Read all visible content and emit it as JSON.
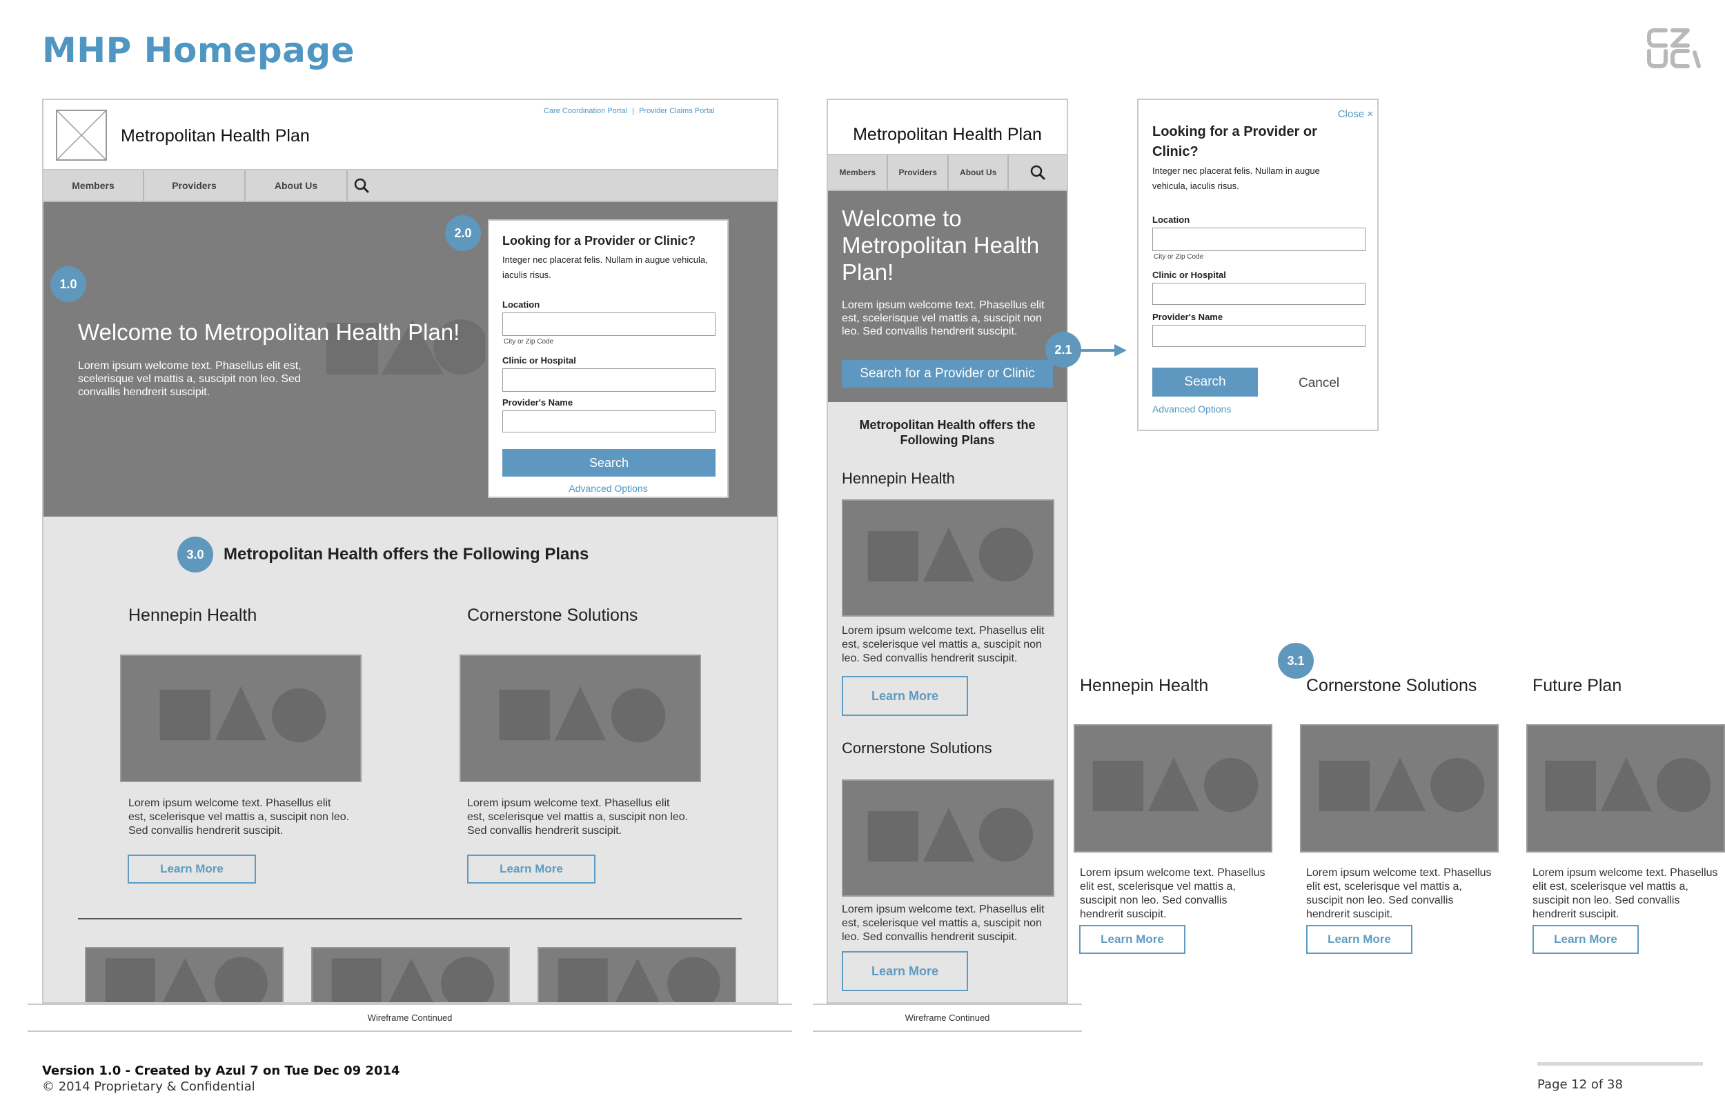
{
  "doc": {
    "title": "MHP Homepage",
    "version_line": "Version 1.0 - Created by Azul 7 on Tue Dec 09 2014",
    "copyright": "© 2014 Proprietary & Confidential",
    "page": "Page 12 of 38",
    "continued": "Wireframe Continued",
    "logo_top": "CZ",
    "logo_bottom": "UC"
  },
  "desktop": {
    "site_name": "Metropolitan Health Plan",
    "util_links": {
      "care": "Care Coordination Portal",
      "divider": "|",
      "claims": "Provider Claims Portal"
    },
    "nav": [
      "Members",
      "Providers",
      "About Us"
    ],
    "hero": {
      "badge": "1.0",
      "heading": "Welcome to Metropolitan Health Plan!",
      "text": "Lorem ipsum welcome text. Phasellus elit est, scelerisque vel mattis a, suscipit non leo. Sed convallis hendrerit suscipit."
    },
    "search": {
      "badge": "2.0",
      "title": "Looking for a Provider or Clinic?",
      "intro": "Integer nec placerat felis. Nullam in augue vehicula, iaculis risus.",
      "location_label": "Location",
      "location_hint": "City or Zip Code",
      "clinic_label": "Clinic or Hospital",
      "provider_label": "Provider's Name",
      "search_button": "Search",
      "advanced": "Advanced Options"
    },
    "plans": {
      "badge": "3.0",
      "heading": "Metropolitan Health offers the Following Plans",
      "items": [
        {
          "name": "Hennepin Health",
          "text": "Lorem ipsum welcome text. Phasellus elit est, scelerisque vel mattis a, suscipit non leo. Sed convallis hendrerit suscipit.",
          "cta": "Learn More"
        },
        {
          "name": "Cornerstone Solutions",
          "text": "Lorem ipsum welcome text. Phasellus elit est, scelerisque vel mattis a, suscipit non leo. Sed convallis hendrerit suscipit.",
          "cta": "Learn More"
        }
      ]
    }
  },
  "mobile": {
    "site_name": "Metropolitan Health Plan",
    "nav": [
      "Members",
      "Providers",
      "About Us"
    ],
    "hero": {
      "heading": "Welcome to Metropolitan Health Plan!",
      "text": "Lorem ipsum welcome text. Phasellus elit est, scelerisque vel mattis a, suscipit non leo. Sed convallis hendrerit suscipit.",
      "cta": "Search for a Provider or Clinic",
      "badge": "2.1"
    },
    "plans_heading": "Metropolitan Health offers the Following Plans",
    "plans": [
      {
        "name": "Hennepin Health",
        "text": "Lorem ipsum welcome text. Phasellus elit est, scelerisque vel mattis a, suscipit non leo. Sed convallis hendrerit suscipit.",
        "cta": "Learn More"
      },
      {
        "name": "Cornerstone Solutions",
        "text": "Lorem ipsum welcome text. Phasellus elit est, scelerisque vel mattis a, suscipit non leo. Sed convallis hendrerit suscipit.",
        "cta": "Learn More"
      }
    ]
  },
  "modal": {
    "close": "Close ×",
    "title": "Looking for a Provider or Clinic?",
    "intro": "Integer nec placerat felis. Nullam in augue vehicula, iaculis risus.",
    "location_label": "Location",
    "location_hint": "City or Zip Code",
    "clinic_label": "Clinic or Hospital",
    "provider_label": "Provider's Name",
    "search_button": "Search",
    "cancel": "Cancel",
    "advanced": "Advanced Options"
  },
  "plan_row": {
    "badge": "3.1",
    "items": [
      {
        "name": "Hennepin Health",
        "text": "Lorem ipsum welcome text. Phasellus elit est, scelerisque vel mattis a, suscipit non leo. Sed convallis hendrerit suscipit.",
        "cta": "Learn More"
      },
      {
        "name": "Cornerstone Solutions",
        "text": "Lorem ipsum welcome text. Phasellus elit est, scelerisque vel mattis a, suscipit non leo. Sed convallis hendrerit suscipit.",
        "cta": "Learn More"
      },
      {
        "name": "Future Plan",
        "text": "Lorem ipsum welcome text. Phasellus elit est, scelerisque vel mattis a, suscipit non leo. Sed convallis hendrerit suscipit.",
        "cta": "Learn More"
      }
    ]
  },
  "colors": {
    "accent": "#4f96c3",
    "placeholder_gray": "#7d7d7d",
    "panel_gray": "#e5e5e5"
  }
}
